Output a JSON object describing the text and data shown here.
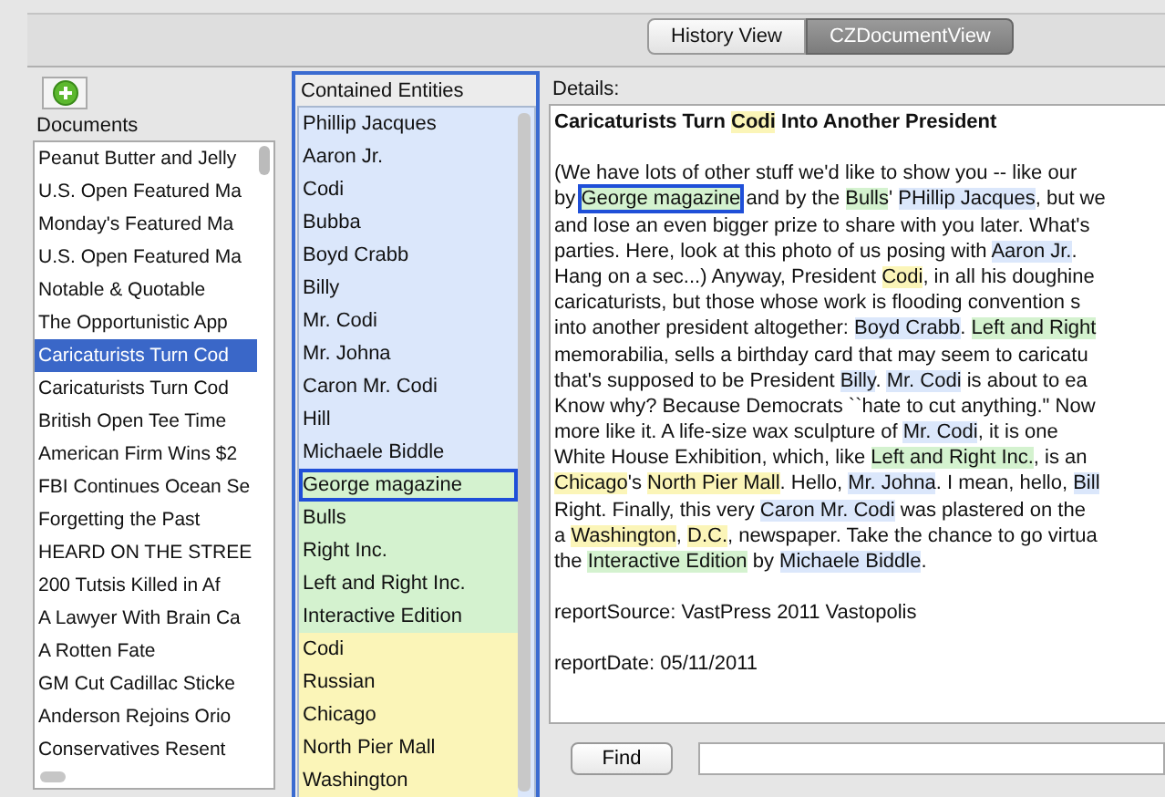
{
  "tabs": [
    {
      "label": "History View",
      "selected": false
    },
    {
      "label": "CZDocumentView",
      "selected": true
    }
  ],
  "documents": {
    "title": "Documents",
    "items": [
      {
        "label": "Peanut Butter and Jelly",
        "selected": false
      },
      {
        "label": "U.S. Open Featured Ma",
        "selected": false
      },
      {
        "label": "Monday's Featured Ma",
        "selected": false
      },
      {
        "label": "U.S. Open Featured Ma",
        "selected": false
      },
      {
        "label": "Notable & Quotable",
        "selected": false
      },
      {
        "label": "The Opportunistic App",
        "selected": false
      },
      {
        "label": "Caricaturists Turn Cod",
        "selected": true
      },
      {
        "label": "Caricaturists Turn Cod",
        "selected": false
      },
      {
        "label": "British Open Tee Time",
        "selected": false
      },
      {
        "label": "American Firm Wins $2",
        "selected": false
      },
      {
        "label": "FBI Continues Ocean Se",
        "selected": false
      },
      {
        "label": "Forgetting the Past",
        "selected": false
      },
      {
        "label": "HEARD ON THE STREE",
        "selected": false
      },
      {
        "label": "200 Tutsis Killed in Af",
        "selected": false
      },
      {
        "label": "A Lawyer With Brain Ca",
        "selected": false
      },
      {
        "label": "A Rotten Fate",
        "selected": false
      },
      {
        "label": "GM Cut Cadillac Sticke",
        "selected": false
      },
      {
        "label": "Anderson Rejoins Orio",
        "selected": false
      },
      {
        "label": "Conservatives Resent",
        "selected": false
      }
    ]
  },
  "entities": {
    "title": "Contained Entities",
    "items": [
      {
        "label": "Phillip Jacques",
        "kind": "person",
        "selected": false
      },
      {
        "label": "Aaron Jr.",
        "kind": "person",
        "selected": false
      },
      {
        "label": "Codi",
        "kind": "person",
        "selected": false
      },
      {
        "label": "Bubba",
        "kind": "person",
        "selected": false
      },
      {
        "label": "Boyd Crabb",
        "kind": "person",
        "selected": false
      },
      {
        "label": "Billy",
        "kind": "person",
        "selected": false
      },
      {
        "label": "Mr. Codi",
        "kind": "person",
        "selected": false
      },
      {
        "label": "Mr. Johna",
        "kind": "person",
        "selected": false
      },
      {
        "label": "Caron Mr. Codi",
        "kind": "person",
        "selected": false
      },
      {
        "label": "Hill",
        "kind": "person",
        "selected": false
      },
      {
        "label": "Michaele Biddle",
        "kind": "person",
        "selected": false
      },
      {
        "label": "George magazine",
        "kind": "organization",
        "selected": true
      },
      {
        "label": "Bulls",
        "kind": "organization",
        "selected": false
      },
      {
        "label": "Right Inc.",
        "kind": "organization",
        "selected": false
      },
      {
        "label": "Left and Right Inc.",
        "kind": "organization",
        "selected": false
      },
      {
        "label": "Interactive Edition",
        "kind": "organization",
        "selected": false
      },
      {
        "label": "Codi",
        "kind": "location",
        "selected": false
      },
      {
        "label": "Russian",
        "kind": "location",
        "selected": false
      },
      {
        "label": "Chicago",
        "kind": "location",
        "selected": false
      },
      {
        "label": "North Pier Mall",
        "kind": "location",
        "selected": false
      },
      {
        "label": "Washington",
        "kind": "location",
        "selected": false
      }
    ]
  },
  "details": {
    "label": "Details:",
    "headline": [
      {
        "text": "Caricaturists Turn ",
        "kind": "text"
      },
      {
        "text": "Codi",
        "kind": "location",
        "selected": false
      },
      {
        "text": " Into Another President",
        "kind": "text"
      }
    ],
    "lines": [
      [
        {
          "text": "(We have lots of other stuff we'd like to show you -- like our",
          "kind": "text"
        }
      ],
      [
        {
          "text": "by ",
          "kind": "text"
        },
        {
          "text": "George magazine",
          "kind": "organization",
          "selected": true
        },
        {
          "text": " and by the ",
          "kind": "text"
        },
        {
          "text": "Bulls",
          "kind": "organization",
          "selected": false
        },
        {
          "text": "' ",
          "kind": "text"
        },
        {
          "text": "PHillip Jacques",
          "kind": "person",
          "selected": false
        },
        {
          "text": ", but we",
          "kind": "text"
        }
      ],
      [
        {
          "text": "and lose an even bigger prize to share with you later. What's",
          "kind": "text"
        }
      ],
      [
        {
          "text": "parties. Here, look at this photo of us posing with ",
          "kind": "text"
        },
        {
          "text": "Aaron Jr.",
          "kind": "person",
          "selected": false
        },
        {
          "text": ".",
          "kind": "text"
        }
      ],
      [
        {
          "text": "Hang on a sec...) Anyway, President ",
          "kind": "text"
        },
        {
          "text": "Codi",
          "kind": "location",
          "selected": false
        },
        {
          "text": ", in all his doughine",
          "kind": "text"
        }
      ],
      [
        {
          "text": "caricaturists, but those whose work is flooding convention s",
          "kind": "text"
        }
      ],
      [
        {
          "text": "into another president altogether: ",
          "kind": "text"
        },
        {
          "text": "Boyd Crabb",
          "kind": "person",
          "selected": false
        },
        {
          "text": ". ",
          "kind": "text"
        },
        {
          "text": "Left and Right",
          "kind": "organization",
          "selected": false
        }
      ],
      [
        {
          "text": "memorabilia, sells a birthday card that may seem to caricatu",
          "kind": "text"
        }
      ],
      [
        {
          "text": "that's supposed to be President ",
          "kind": "text"
        },
        {
          "text": "Billy",
          "kind": "person",
          "selected": false
        },
        {
          "text": ". ",
          "kind": "text"
        },
        {
          "text": "Mr. Codi",
          "kind": "person",
          "selected": false
        },
        {
          "text": " is about to ea",
          "kind": "text"
        }
      ],
      [
        {
          "text": "Know why? Because Democrats ``hate to cut anything.\" Now",
          "kind": "text"
        }
      ],
      [
        {
          "text": "more like it. A life-size wax sculpture of ",
          "kind": "text"
        },
        {
          "text": "Mr. Codi",
          "kind": "person",
          "selected": false
        },
        {
          "text": ", it is one",
          "kind": "text"
        }
      ],
      [
        {
          "text": "White House Exhibition, which, like ",
          "kind": "text"
        },
        {
          "text": "Left and Right Inc.",
          "kind": "organization",
          "selected": false
        },
        {
          "text": ", is an",
          "kind": "text"
        }
      ],
      [
        {
          "text": "Chicago",
          "kind": "location",
          "selected": false
        },
        {
          "text": "'s ",
          "kind": "text"
        },
        {
          "text": "North Pier Mall",
          "kind": "location",
          "selected": false
        },
        {
          "text": ". Hello, ",
          "kind": "text"
        },
        {
          "text": "Mr. Johna",
          "kind": "person",
          "selected": false
        },
        {
          "text": ". I mean, hello, ",
          "kind": "text"
        },
        {
          "text": "Bill",
          "kind": "person",
          "selected": false
        }
      ],
      [
        {
          "text": "Right. Finally, this very ",
          "kind": "text"
        },
        {
          "text": "Caron Mr. Codi",
          "kind": "person",
          "selected": false
        },
        {
          "text": " was plastered on the",
          "kind": "text"
        }
      ],
      [
        {
          "text": "a ",
          "kind": "text"
        },
        {
          "text": "Washington",
          "kind": "location",
          "selected": false
        },
        {
          "text": ", ",
          "kind": "text"
        },
        {
          "text": "D.C.",
          "kind": "location",
          "selected": false
        },
        {
          "text": ", newspaper. Take the chance to go virtua",
          "kind": "text"
        }
      ],
      [
        {
          "text": "the ",
          "kind": "text"
        },
        {
          "text": "Interactive Edition",
          "kind": "organization",
          "selected": false
        },
        {
          "text": " by ",
          "kind": "text"
        },
        {
          "text": "Michaele Biddle",
          "kind": "person",
          "selected": false
        },
        {
          "text": ".",
          "kind": "text"
        }
      ]
    ],
    "source": "reportSource: VastPress 2011 Vastopolis",
    "date": "reportDate: 05/11/2011"
  },
  "find": {
    "button": "Find"
  }
}
